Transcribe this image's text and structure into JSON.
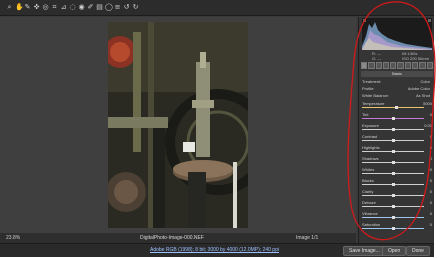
{
  "toolbar": {
    "tools": [
      {
        "icon": "zoom-icon",
        "glyph": "⌕"
      },
      {
        "icon": "hand-icon",
        "glyph": "✋"
      },
      {
        "icon": "white-balance-icon",
        "glyph": "✎"
      },
      {
        "icon": "color-sampler-icon",
        "glyph": "✜"
      },
      {
        "icon": "targeted-adjustment-icon",
        "glyph": "◎"
      },
      {
        "icon": "crop-icon",
        "glyph": "⌗"
      },
      {
        "icon": "straighten-icon",
        "glyph": "⊿"
      },
      {
        "icon": "spot-removal-icon",
        "glyph": "◌"
      },
      {
        "icon": "red-eye-icon",
        "glyph": "◉"
      },
      {
        "icon": "adjustment-brush-icon",
        "glyph": "✐"
      },
      {
        "icon": "graduated-filter-icon",
        "glyph": "▤"
      },
      {
        "icon": "radial-filter-icon",
        "glyph": "◯"
      },
      {
        "icon": "preferences-icon",
        "glyph": "≡"
      },
      {
        "icon": "rotate-left-icon",
        "glyph": "↺"
      },
      {
        "icon": "rotate-right-icon",
        "glyph": "↻"
      }
    ]
  },
  "status": {
    "zoom": "23.8%",
    "filename": "DigitalPhoto-Image-000.NEF",
    "image_counter": "Image 1/1"
  },
  "bottom": {
    "workflow_link": "Adobe RGB (1998); 8 bit; 3000 by 4000 (12.0MP); 240 ppi",
    "save_label": "Save Image...",
    "open_label": "Open",
    "done_label": "Done"
  },
  "panel": {
    "readout": [
      "R: ---",
      "G: ---",
      "f/8 1/60s",
      "ISO 200 50mm"
    ],
    "section_title": "Basic",
    "treatment_label": "Treatment:",
    "treatment_value": "Color",
    "profile_label": "Profile:",
    "profile_value": "Adobe Color",
    "wb_label": "White Balance:",
    "wb_value": "As Shot",
    "sliders": [
      {
        "label": "Temperature",
        "value": "5000",
        "pos": 0.55,
        "color": "#e6c56e"
      },
      {
        "label": "Tint",
        "value": "0",
        "pos": 0.5,
        "color": "#c07bd1"
      },
      {
        "label": "Exposure",
        "value": "0.00",
        "pos": 0.5,
        "color": "#cfcfcf"
      },
      {
        "label": "Contrast",
        "value": "0",
        "pos": 0.5,
        "color": "#cfcfcf"
      },
      {
        "label": "Highlights",
        "value": "0",
        "pos": 0.5,
        "color": "#cfcfcf"
      },
      {
        "label": "Shadows",
        "value": "0",
        "pos": 0.5,
        "color": "#cfcfcf"
      },
      {
        "label": "Whites",
        "value": "0",
        "pos": 0.5,
        "color": "#cfcfcf"
      },
      {
        "label": "Blacks",
        "value": "0",
        "pos": 0.5,
        "color": "#cfcfcf"
      },
      {
        "label": "Clarity",
        "value": "0",
        "pos": 0.5,
        "color": "#cfcfcf"
      },
      {
        "label": "Dehaze",
        "value": "0",
        "pos": 0.5,
        "color": "#cfcfcf"
      },
      {
        "label": "Vibrance",
        "value": "0",
        "pos": 0.5,
        "color": "#9fc5e8"
      },
      {
        "label": "Saturation",
        "value": "0",
        "pos": 0.5,
        "color": "#9fc5e8"
      }
    ]
  },
  "colors": {
    "annotation": "#d11a1a",
    "accent": "#9cc0ff"
  }
}
